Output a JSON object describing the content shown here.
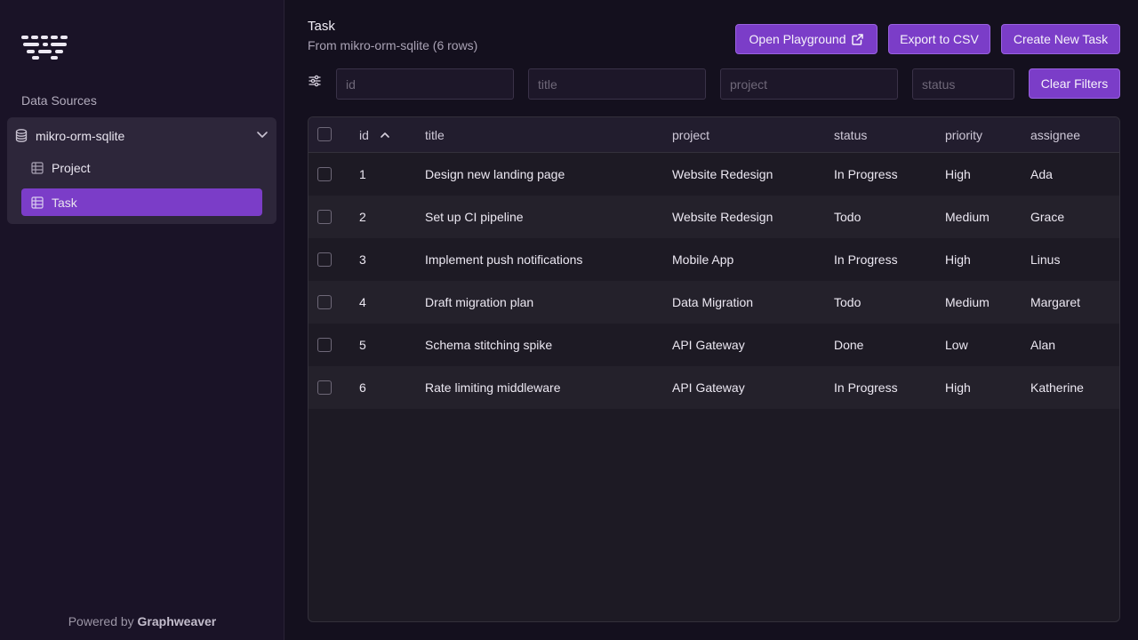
{
  "sidebar": {
    "section_label": "Data Sources",
    "source": {
      "name": "mikro-orm-sqlite",
      "icon": "database-icon",
      "expanded": true
    },
    "entities": [
      {
        "label": "Project",
        "icon": "table-icon",
        "active": false
      },
      {
        "label": "Task",
        "icon": "table-icon",
        "active": true
      }
    ],
    "footer_prefix": "Powered by",
    "footer_brand": "Graphweaver"
  },
  "header": {
    "title": "Task",
    "subtitle": "From mikro-orm-sqlite (6 rows)",
    "buttons": {
      "playground": "Open Playground",
      "export": "Export to CSV",
      "create": "Create New Task"
    }
  },
  "filters": {
    "placeholders": [
      "id",
      "title",
      "project",
      "status"
    ],
    "values": [
      "",
      "",
      "",
      ""
    ],
    "clear_label": "Clear Filters"
  },
  "table": {
    "columns": [
      "id",
      "title",
      "project",
      "status",
      "priority",
      "assignee"
    ],
    "sort": {
      "column": "id",
      "direction": "ascending"
    },
    "rows": [
      {
        "id": "1",
        "title": "Design new landing page",
        "project": "Website Redesign",
        "status": "In Progress",
        "priority": "High",
        "assignee": "Ada"
      },
      {
        "id": "2",
        "title": "Set up CI pipeline",
        "project": "Website Redesign",
        "status": "Todo",
        "priority": "Medium",
        "assignee": "Grace"
      },
      {
        "id": "3",
        "title": "Implement push notifications",
        "project": "Mobile App",
        "status": "In Progress",
        "priority": "High",
        "assignee": "Linus"
      },
      {
        "id": "4",
        "title": "Draft migration plan",
        "project": "Data Migration",
        "status": "Todo",
        "priority": "Medium",
        "assignee": "Margaret"
      },
      {
        "id": "5",
        "title": "Schema stitching spike",
        "project": "API Gateway",
        "status": "Done",
        "priority": "Low",
        "assignee": "Alan"
      },
      {
        "id": "6",
        "title": "Rate limiting middleware",
        "project": "API Gateway",
        "status": "In Progress",
        "priority": "High",
        "assignee": "Katherine"
      }
    ]
  },
  "colors": {
    "accent": "#7b3dc8",
    "background": "#14101e",
    "sidebar": "#1a1327"
  }
}
